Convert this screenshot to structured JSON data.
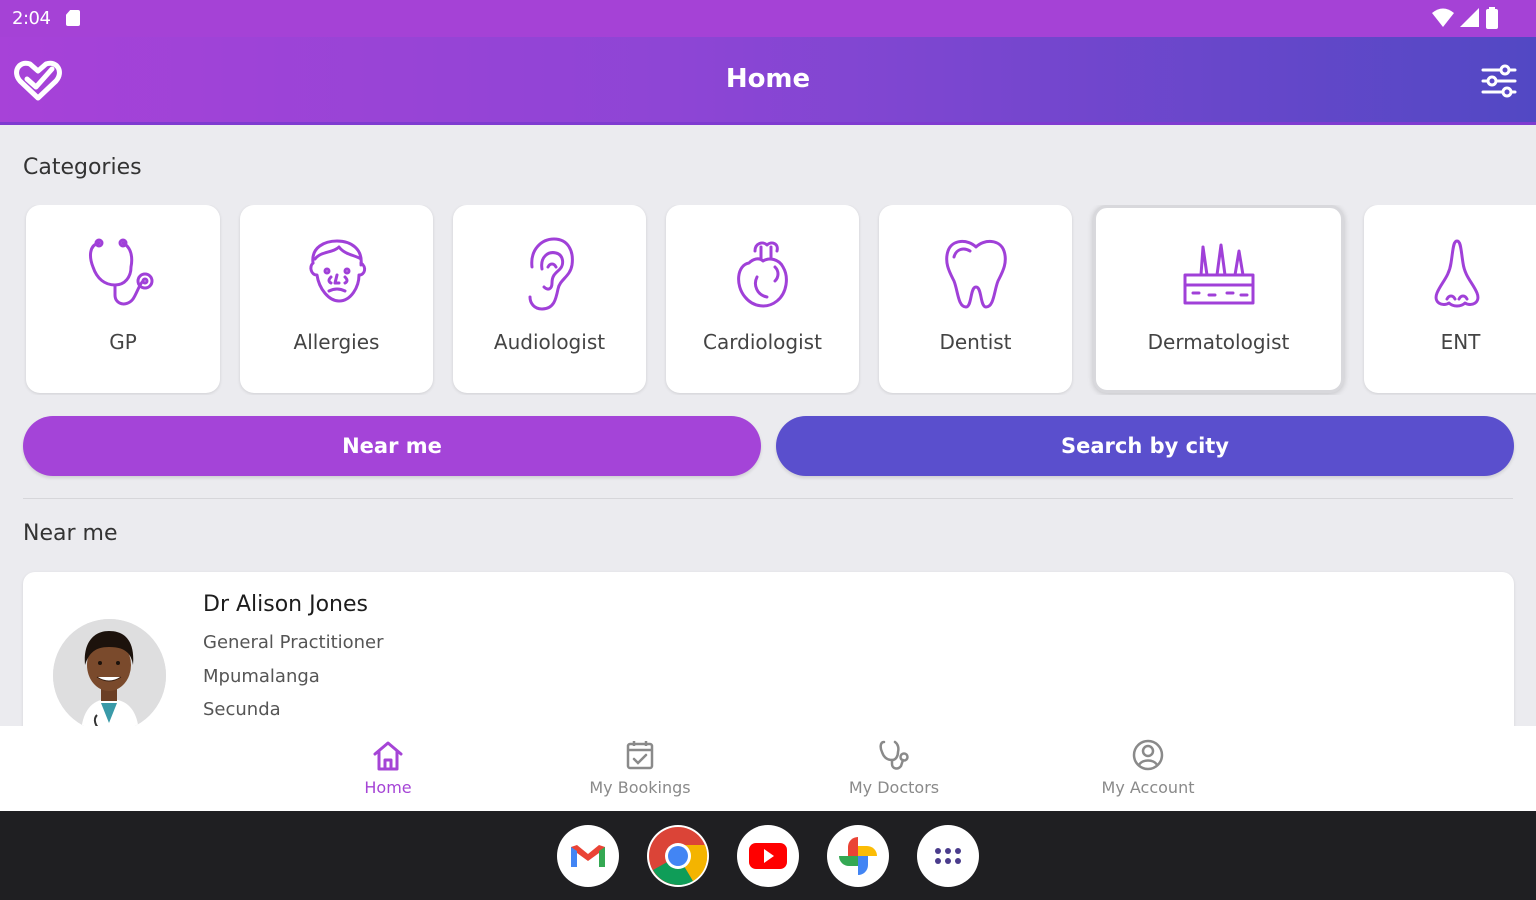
{
  "status_bar": {
    "time": "2:04",
    "icons": [
      "sd-card-icon",
      "wifi-icon",
      "signal-icon",
      "battery-icon"
    ]
  },
  "app_bar": {
    "title": "Home",
    "logo_icon": "heart-check-icon",
    "filter_icon": "sliders-icon"
  },
  "categories": {
    "title": "Categories",
    "items": [
      {
        "label": "GP",
        "icon": "stethoscope-icon",
        "selected": false
      },
      {
        "label": "Allergies",
        "icon": "allergy-face-icon",
        "selected": false
      },
      {
        "label": "Audiologist",
        "icon": "ear-icon",
        "selected": false
      },
      {
        "label": "Cardiologist",
        "icon": "heart-organ-icon",
        "selected": false
      },
      {
        "label": "Dentist",
        "icon": "tooth-icon",
        "selected": false
      },
      {
        "label": "Dermatologist",
        "icon": "skin-layers-icon",
        "selected": true
      },
      {
        "label": "ENT",
        "icon": "nose-icon",
        "selected": false
      }
    ]
  },
  "buttons": {
    "near_me": "Near me",
    "search_by_city": "Search by city"
  },
  "near_me_section": {
    "title": "Near me",
    "doctors": [
      {
        "name": "Dr Alison Jones",
        "specialty": "General Practitioner",
        "province": "Mpumalanga",
        "city": "Secunda"
      }
    ]
  },
  "bottom_nav": {
    "items": [
      {
        "label": "Home",
        "icon": "home-icon",
        "active": true
      },
      {
        "label": "My Bookings",
        "icon": "calendar-check-icon",
        "active": false
      },
      {
        "label": "My Doctors",
        "icon": "stethoscope-icon",
        "active": false
      },
      {
        "label": "My Account",
        "icon": "user-circle-icon",
        "active": false
      }
    ]
  },
  "taskbar": {
    "apps": [
      "gmail-icon",
      "chrome-icon",
      "youtube-icon",
      "photos-icon",
      "app-drawer-icon"
    ]
  },
  "colors": {
    "primary_purple": "#a542d6",
    "secondary_indigo": "#5a4fcd",
    "background": "#ebebef",
    "icon_purple": "#a040d8"
  }
}
